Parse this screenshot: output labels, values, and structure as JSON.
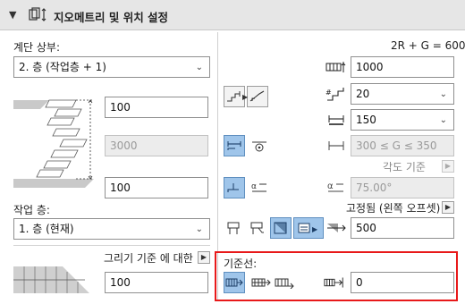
{
  "header": {
    "title": "지오메트리 및 위치 설정"
  },
  "left": {
    "top_label": "계단 상부:",
    "top_select": "2. 층 (작업층 + 1)",
    "offset_top_value": "100",
    "height_value": "3000",
    "offset_bottom_value": "100",
    "home_story_label": "작업 층:",
    "home_story_select": "1. 층 (현재)",
    "drawing_label": "그리기 기준 에 대한",
    "drawing_value": "100"
  },
  "right": {
    "rule_text": "2R + G = 600",
    "riser_count_value": "1000",
    "riser_height_select": "20",
    "tread_depth_select": "150",
    "tread_range_value": "300 ≤ G ≤ 350",
    "angle_label": "각도 기준",
    "angle_value": "75.00°",
    "flight_width_label": "고정됨 (왼쪽 오프셋)",
    "flight_width_value": "500",
    "baseline_label": "기준선:",
    "baseline_offset_value": "0"
  }
}
